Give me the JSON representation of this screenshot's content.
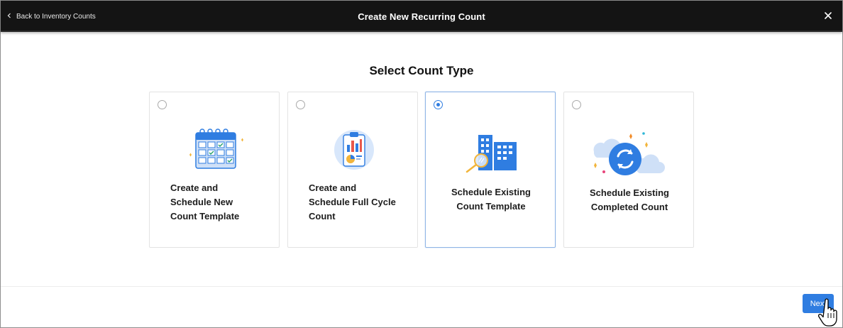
{
  "header": {
    "back_label": "Back to Inventory Counts",
    "title": "Create New Recurring Count",
    "back_icon": "chevron-left-icon",
    "close_icon": "close-icon"
  },
  "main": {
    "heading": "Select Count Type",
    "selected_option": "schedule-existing-count-template",
    "options": [
      {
        "id": "create-schedule-new-template",
        "lines": [
          "Create and",
          "Schedule New",
          "Count Template"
        ],
        "icon": "calendar-icon",
        "selected": false
      },
      {
        "id": "create-schedule-full-cycle",
        "lines": [
          "Create and",
          "Schedule Full Cycle",
          "Count"
        ],
        "icon": "clipboard-chart-icon",
        "selected": false
      },
      {
        "id": "schedule-existing-count-template",
        "lines": [
          "Schedule Existing",
          "Count Template"
        ],
        "icon": "buildings-search-icon",
        "selected": true
      },
      {
        "id": "schedule-existing-completed-count",
        "lines": [
          "Schedule Existing",
          "Completed Count"
        ],
        "icon": "cloud-sync-icon",
        "selected": false
      }
    ]
  },
  "footer": {
    "next_label": "Next",
    "cursor_icon": "hand-pointer-icon"
  },
  "colors": {
    "accent": "#2f7de1",
    "topbar": "#141414",
    "selected_border": "#8fb4e6"
  }
}
